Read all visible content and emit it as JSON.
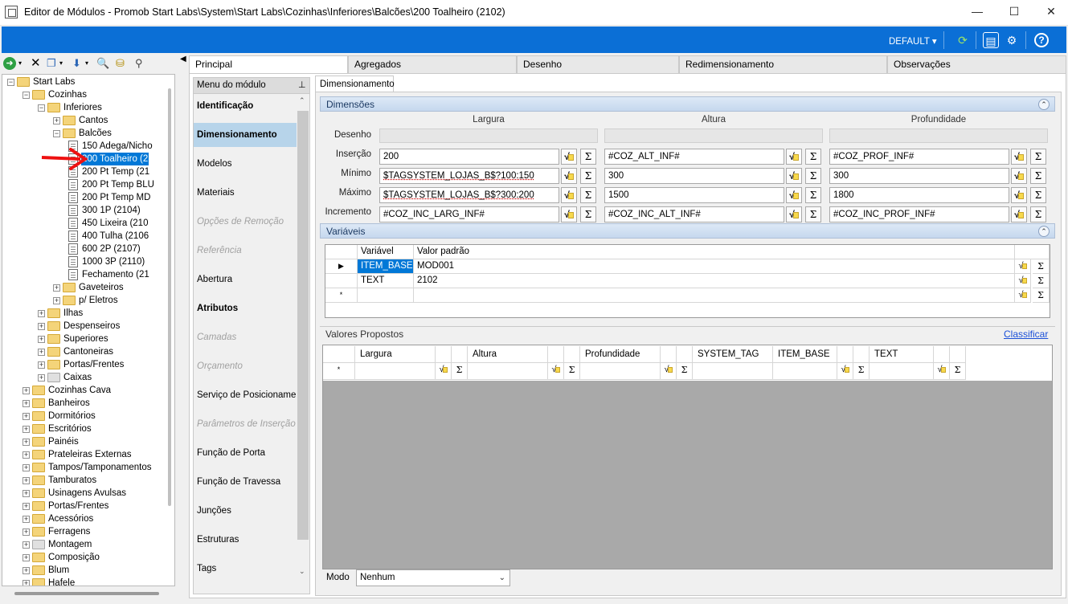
{
  "window": {
    "title": "Editor de Módulos - Promob Start Labs\\System\\Start Labs\\Cozinhas\\Inferiores\\Balcões\\200 Toalheiro (2102)"
  },
  "ribbon": {
    "profile": "DEFAULT"
  },
  "tree": {
    "items": [
      {
        "label": "Start Labs"
      },
      {
        "label": "Cozinhas"
      },
      {
        "label": "Inferiores"
      },
      {
        "label": "Cantos"
      },
      {
        "label": "Balcões"
      },
      {
        "label": "150 Adega/Nicho"
      },
      {
        "label": "200 Toalheiro (2"
      },
      {
        "label": "200 Pt Temp (21"
      },
      {
        "label": "200 Pt Temp BLU"
      },
      {
        "label": "200 Pt Temp MD"
      },
      {
        "label": "300 1P (2104)"
      },
      {
        "label": "450 Lixeira (210"
      },
      {
        "label": "400 Tulha (2106"
      },
      {
        "label": "600 2P (2107)"
      },
      {
        "label": "1000 3P (2110)"
      },
      {
        "label": "Fechamento (21"
      },
      {
        "label": "Gaveteiros"
      },
      {
        "label": "p/ Eletros"
      },
      {
        "label": "Ilhas"
      },
      {
        "label": "Despenseiros"
      },
      {
        "label": "Superiores"
      },
      {
        "label": "Cantoneiras"
      },
      {
        "label": "Portas/Frentes"
      },
      {
        "label": "Caixas"
      },
      {
        "label": "Cozinhas Cava"
      },
      {
        "label": "Banheiros"
      },
      {
        "label": "Dormitórios"
      },
      {
        "label": "Escritórios"
      },
      {
        "label": "Painéis"
      },
      {
        "label": "Prateleiras Externas"
      },
      {
        "label": "Tampos/Tamponamentos"
      },
      {
        "label": "Tamburatos"
      },
      {
        "label": "Usinagens Avulsas"
      },
      {
        "label": "Portas/Frentes"
      },
      {
        "label": "Acessórios"
      },
      {
        "label": "Ferragens"
      },
      {
        "label": "Montagem"
      },
      {
        "label": "Composição"
      },
      {
        "label": "Blum"
      },
      {
        "label": "Hafele"
      }
    ]
  },
  "tabs": {
    "main": [
      "Principal",
      "Agregados",
      "Desenho",
      "Redimensionamento",
      "Observações"
    ],
    "sub": "Dimensionamento"
  },
  "menu": {
    "header": "Menu do módulo",
    "items": [
      {
        "label": "Identificação"
      },
      {
        "label": "Dimensionamento"
      },
      {
        "label": "Modelos"
      },
      {
        "label": "Materiais"
      },
      {
        "label": "Opções de Remoção"
      },
      {
        "label": "Referência"
      },
      {
        "label": "Abertura"
      },
      {
        "label": "Atributos"
      },
      {
        "label": "Camadas"
      },
      {
        "label": "Orçamento"
      },
      {
        "label": "Serviço de Posicionamen"
      },
      {
        "label": "Parâmetros de Inserção"
      },
      {
        "label": "Função de Porta"
      },
      {
        "label": "Função de Travessa"
      },
      {
        "label": "Junções"
      },
      {
        "label": "Estruturas"
      },
      {
        "label": "Tags"
      }
    ]
  },
  "dimensoes": {
    "title": "Dimensões",
    "columns": [
      "Largura",
      "Altura",
      "Profundidade"
    ],
    "rows": [
      {
        "label": "Desenho",
        "values": [
          "",
          "",
          ""
        ]
      },
      {
        "label": "Inserção",
        "values": [
          "200",
          "#COZ_ALT_INF#",
          "#COZ_PROF_INF#"
        ]
      },
      {
        "label": "Mínimo",
        "values": [
          "$TAGSYSTEM_LOJAS_B$?100:150",
          "300",
          "300"
        ]
      },
      {
        "label": "Máximo",
        "values": [
          "$TAGSYSTEM_LOJAS_B$?300:200",
          "1500",
          "1800"
        ]
      },
      {
        "label": "Incremento",
        "values": [
          "#COZ_INC_LARG_INF#",
          "#COZ_INC_ALT_INF#",
          "#COZ_INC_PROF_INF#"
        ]
      }
    ],
    "func_glyphs": {
      "sqrt": "√",
      "sigma": "Σ"
    }
  },
  "variaveis": {
    "title": "Variáveis",
    "headers": [
      "Variável",
      "Valor padrão"
    ],
    "rows": [
      {
        "var": "ITEM_BASE",
        "value": "MOD001"
      },
      {
        "var": "TEXT",
        "value": "2102"
      }
    ],
    "new_row_marker": "*"
  },
  "valores": {
    "title": "Valores Propostos",
    "link": "Classificar",
    "headers": [
      "Largura",
      "Altura",
      "Profundidade",
      "SYSTEM_TAG",
      "ITEM_BASE",
      "TEXT"
    ],
    "new_row_marker": "*"
  },
  "modo": {
    "label": "Modo",
    "value": "Nenhum"
  }
}
